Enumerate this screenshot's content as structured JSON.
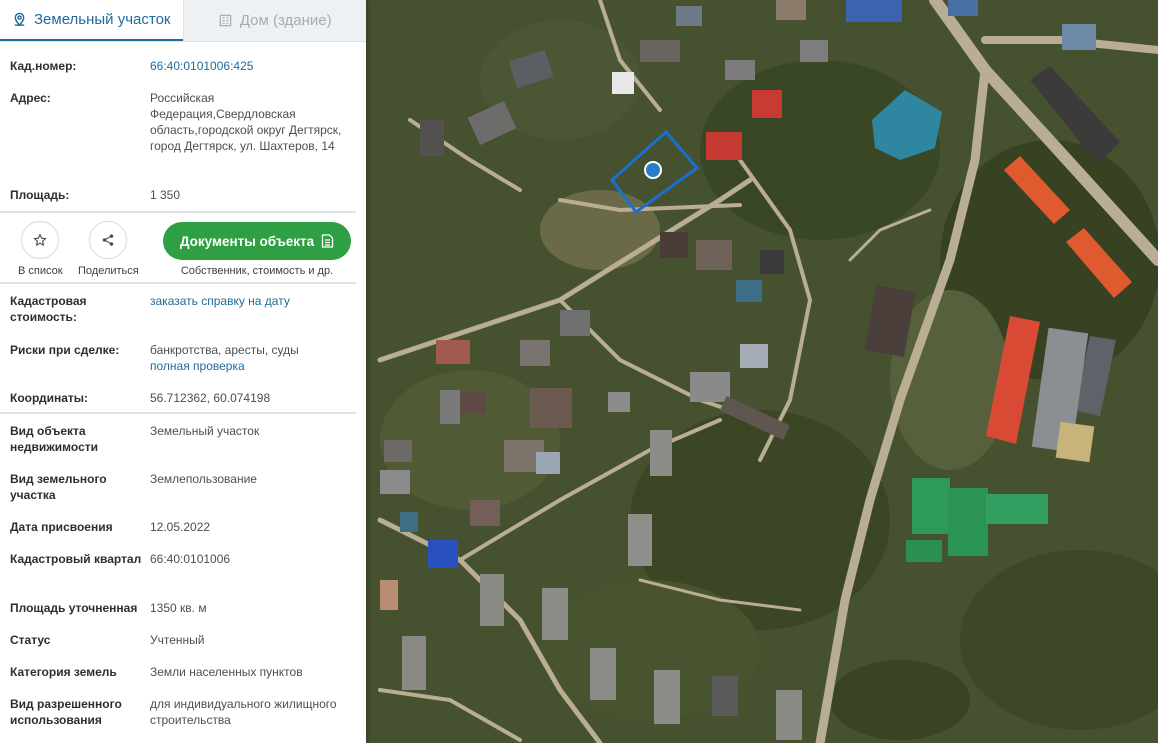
{
  "tabs": [
    {
      "label": "Земельный участок",
      "icon": "map-pin-icon",
      "active": true
    },
    {
      "label": "Дом (здание)",
      "icon": "building-icon",
      "active": false
    }
  ],
  "fields": {
    "cad_number": {
      "label": "Кад.номер:",
      "value": "66:40:0101006:425"
    },
    "address": {
      "label": "Адрес:",
      "value": "Российская Федерация,Свердловская область,городской округ Дегтярск, город Дегтярск, ул. Шахтеров, 14"
    },
    "area": {
      "label": "Площадь:",
      "value": "1 350"
    },
    "cad_cost": {
      "label": "Кадастровая стоимость:",
      "link": "заказать справку на дату"
    },
    "risks": {
      "label": "Риски при сделке:",
      "value": "банкротства, аресты, суды",
      "link": "полная проверка"
    },
    "coords": {
      "label": "Координаты:",
      "value": "56.712362, 60.074198"
    },
    "object_type": {
      "label": "Вид объекта недвижимости",
      "value": "Земельный участок"
    },
    "land_type": {
      "label": "Вид земельного участка",
      "value": "Землепользование"
    },
    "assign_date": {
      "label": "Дата присвоения",
      "value": "12.05.2022"
    },
    "cad_quarter": {
      "label": "Кадастровый квартал",
      "value": "66:40:0101006"
    },
    "refined_area": {
      "label": "Площадь уточненная",
      "value": "1350 кв. м"
    },
    "status": {
      "label": "Статус",
      "value": "Учтенный"
    },
    "land_category": {
      "label": "Категория земель",
      "value": "Земли населенных пунктов"
    },
    "permitted_use": {
      "label": "Вид разрешенного использования",
      "value": "для индивидуального жилищного строительства"
    }
  },
  "actions": {
    "favorite_label": "В список",
    "share_label": "Поделиться",
    "documents_label": "Документы объекта",
    "documents_sub": "Собственник, стоимость и др."
  },
  "colors": {
    "accent": "#1f6b9a",
    "button_green": "#2ea043",
    "parcel_outline": "#1a6fd1"
  }
}
